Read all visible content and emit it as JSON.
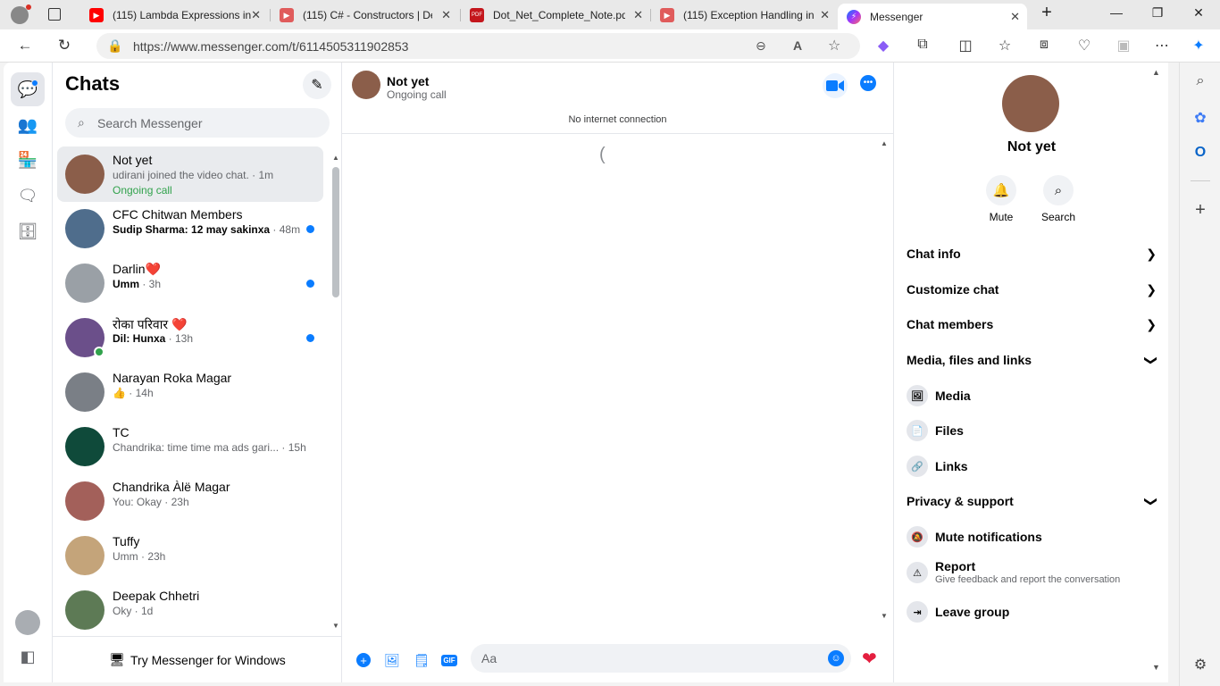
{
  "browser": {
    "tabs": [
      {
        "title": "(115) Lambda Expressions in",
        "icon": "youtube-icon",
        "color": "#ff0000"
      },
      {
        "title": "(115) C# - Constructors | De",
        "icon": "youtube-icon",
        "color": "#ff0000"
      },
      {
        "title": "Dot_Net_Complete_Note.pdf",
        "icon": "pdf-icon",
        "color": "#c4161c"
      },
      {
        "title": "(115) Exception Handling in",
        "icon": "youtube-icon",
        "color": "#ff0000"
      },
      {
        "title": "Messenger",
        "icon": "messenger-icon",
        "color": "#a334fa"
      }
    ],
    "url": "https://www.messenger.com/t/6114505311902853"
  },
  "chats": {
    "title": "Chats",
    "search_placeholder": "Search Messenger",
    "items": [
      {
        "name": "Not yet",
        "preview": "udirani joined the video chat.",
        "time": " · 1m",
        "extra": "Ongoing call",
        "unread": false,
        "active": true,
        "avatar_color": "#8b5e4a"
      },
      {
        "name": "CFC Chitwan Members",
        "preview": "Sudip Sharma: 12 may sakinxa",
        "time": " · 48m",
        "unread": true,
        "avatar_color": "#4f6d8c"
      },
      {
        "name": "Darlin❤️",
        "preview": "Umm",
        "time": " · 3h",
        "unread": true,
        "avatar_color": "#9aa0a6"
      },
      {
        "name": "रोका परिवार ❤️",
        "preview": "Dil: Hunxa",
        "time": " · 13h",
        "unread": true,
        "avatar_color": "#6b4f8a"
      },
      {
        "name": "Narayan Roka Magar",
        "preview": "👍",
        "time": " · 14h",
        "unread": false,
        "avatar_color": "#7a7f86"
      },
      {
        "name": "TC",
        "preview": "Chandrika: time time ma ads gari...",
        "time": " · 15h",
        "unread": false,
        "avatar_color": "#0f4a3a"
      },
      {
        "name": "Chandrika Àlë Magar",
        "preview": "You: Okay",
        "time": " · 23h",
        "unread": false,
        "avatar_color": "#a3605a"
      },
      {
        "name": "Tuffy",
        "preview": "Umm",
        "time": " · 23h",
        "unread": false,
        "avatar_color": "#c4a47a"
      },
      {
        "name": "Deepak Chhetri",
        "preview": "Oky",
        "time": " · 1d",
        "unread": false,
        "avatar_color": "#5d7a55"
      }
    ],
    "try_windows": "Try Messenger for Windows"
  },
  "conversation": {
    "title": "Not yet",
    "subtitle": "Ongoing call",
    "banner": "No internet connection",
    "composer_placeholder": "Aa",
    "spinner": "("
  },
  "info_panel": {
    "name": "Not yet",
    "actions": [
      {
        "label": "Mute",
        "icon": "bell-icon"
      },
      {
        "label": "Search",
        "icon": "search-icon"
      }
    ],
    "sections": [
      {
        "label": "Chat info",
        "state": "collapsed"
      },
      {
        "label": "Customize chat",
        "state": "collapsed"
      },
      {
        "label": "Chat members",
        "state": "collapsed"
      },
      {
        "label": "Media, files and links",
        "state": "expanded"
      },
      {
        "label": "Privacy & support",
        "state": "expanded"
      }
    ],
    "media_items": [
      "Media",
      "Files",
      "Links"
    ],
    "privacy_items": [
      {
        "label": "Mute notifications"
      },
      {
        "label": "Report",
        "desc": "Give feedback and report the conversation"
      },
      {
        "label": "Leave group"
      }
    ]
  },
  "colors": {
    "accent": "#0a7cff",
    "online": "#31a24c",
    "heart": "#e41e3f"
  }
}
